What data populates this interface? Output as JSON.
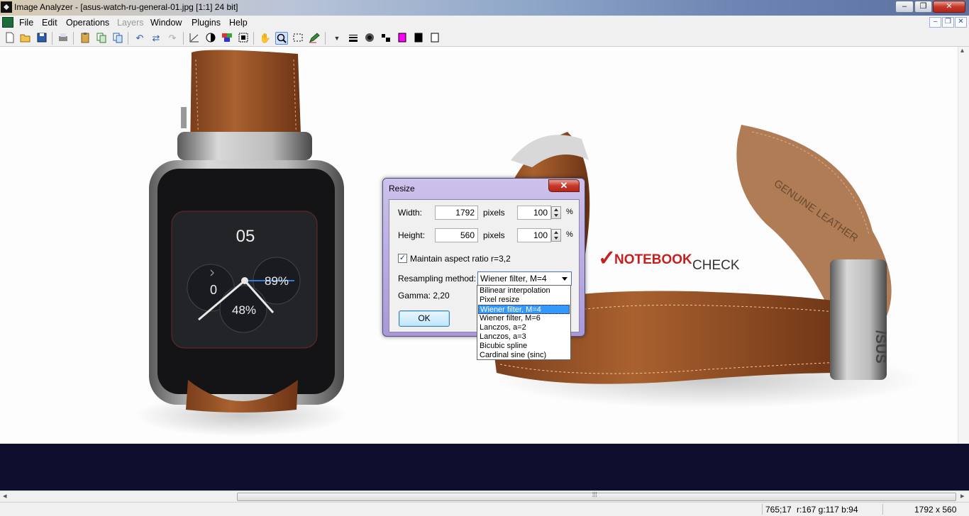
{
  "window": {
    "title": "Image Analyzer - [asus-watch-ru-general-01.jpg [1:1] 24 bit]",
    "buttons": {
      "minimize": "–",
      "maximize": "❐",
      "close": "✕"
    }
  },
  "menubar": {
    "items": [
      "File",
      "Edit",
      "Operations",
      "Layers",
      "Window",
      "Plugins",
      "Help"
    ],
    "disabled": [
      "Layers"
    ],
    "mdi_buttons": {
      "minimize": "–",
      "restore": "❐",
      "close": "✕"
    }
  },
  "toolbar": {
    "icons": [
      "new-icon",
      "open-icon",
      "save-icon",
      "scan-icon",
      "paste-icon",
      "copy-icon",
      "duplicate-icon",
      "undo-icon",
      "flip-icon",
      "redo-icon",
      "histogram-icon",
      "contrast-icon",
      "color-icon",
      "barcode-icon",
      "hand-icon",
      "zoom-icon",
      "select-icon",
      "pencil-icon",
      "dropdown-icon",
      "line-width-icon",
      "brush-icon",
      "dots-icon",
      "magenta-color-icon",
      "black-color-icon",
      "white-color-icon"
    ],
    "active": "zoom-icon"
  },
  "image": {
    "watch_face": {
      "hour": "05",
      "left_dial": "0",
      "right_dial": "89%",
      "bottom_dial": "48%"
    },
    "watermark": {
      "check": "✓",
      "brand": "NOTEBOOK",
      "suffix": "CHECK"
    },
    "strap_text": "GENUINE LEATHER",
    "clasp_text": "/SUS"
  },
  "dialog": {
    "title": "Resize",
    "close_label": "✕",
    "width_label": "Width:",
    "width_value": "1792",
    "width_unit": "pixels",
    "width_percent": "100",
    "height_label": "Height:",
    "height_value": "560",
    "height_unit": "pixels",
    "height_percent": "100",
    "percent_symbol": "%",
    "maintain_aspect": "Maintain aspect ratio r=3,2",
    "maintain_checked": "✓",
    "resampling_label": "Resampling method:",
    "resampling_selected": "Wiener filter, M=4",
    "gamma": "Gamma: 2,20",
    "ok_label": "OK",
    "resampling_options": [
      "Bilinear interpolation",
      "Pixel resize",
      "Wiener filter, M=4",
      "Wiener filter, M=6",
      "Lanczos, a=2",
      "Lanczos, a=3",
      "Bicubic spline",
      "Cardinal sine (sinc)"
    ],
    "selected_index": 2
  },
  "scrollbar": {
    "left_arrow": "◂",
    "right_arrow": "▸",
    "grip": "⦙⦙⦙",
    "up_arrow": "▴",
    "down_arrow": "▾"
  },
  "statusbar": {
    "coords": "765;17",
    "rgb": "r:167 g:117 b:94",
    "dimensions": "1792 x 560"
  }
}
